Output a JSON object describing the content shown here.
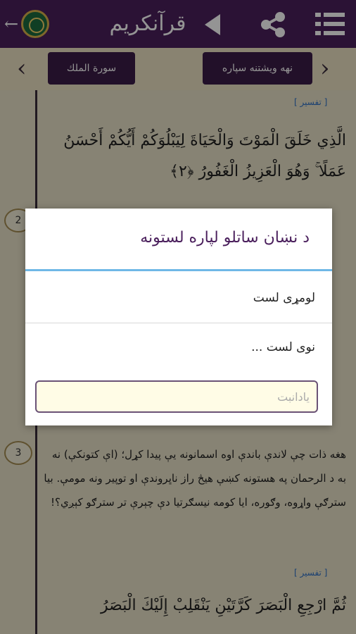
{
  "header": {
    "title": "قرآنکریم",
    "back_icon": "back-arrow-icon",
    "logo_icon": "quran-logo-icon",
    "speaker_icon": "speaker-icon",
    "share_icon": "share-icon",
    "menu_icon": "menu-icon"
  },
  "navbar": {
    "surah_label": "سورة الملك",
    "bookmark_label": "نهه ويشتنه سپاره",
    "prev_icon": "chevron-left-icon",
    "next_icon": "chevron-right-icon"
  },
  "content": {
    "tafsir_label": "[ تفسير ]",
    "verse2_arabic": "الَّذِي خَلَقَ الْمَوْتَ وَالْحَيَاةَ لِيَبْلُوَكُمْ أَيُّكُمْ أَحْسَنُ عَمَلًا ۚ وَهُوَ الْعَزِيزُ الْغَفُورُ ﴿٢﴾",
    "verse3_translation": "هغه ذات چې لاندې باندې اوه اسمانونه يې پيدا کړل؛ (اې کتونکې) نه به د الرحمان په هستونه کښې هيڅ راز ناڀروندې او توپير ونه مومې. بيا سترګې واړوه، وګوره، ايا کومه نيسګرتيا دې چېرې تر سترګو کېږي؟!",
    "verse4_arabic": "ثُمَّ ارْجِعِ الْبَصَرَ كَرَّتَيْنِ يَنْقَلِبْ إِلَيْكَ الْبَصَرُ",
    "ayah2": "2",
    "ayah3": "3"
  },
  "dialog": {
    "title": "د نښان ساتلو لپاره لستونه",
    "option1": "لومړی لست",
    "option2": "نوی لست ...",
    "note_placeholder": "يادانبت"
  },
  "colors": {
    "header_bg": "#4a1f5c",
    "accent_line": "#6fb8e6",
    "page_bg": "#e9e2c8"
  }
}
